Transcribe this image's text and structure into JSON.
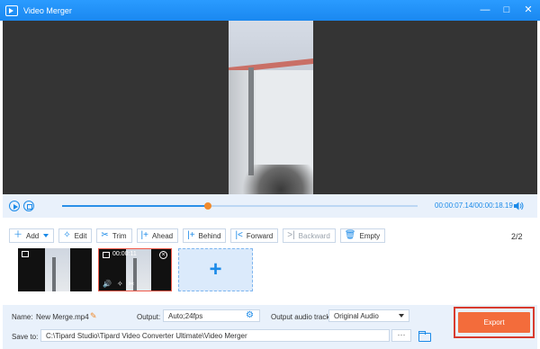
{
  "window": {
    "title": "Video Merger",
    "minimize": "—",
    "maximize": "□",
    "close": "✕"
  },
  "player": {
    "current_time": "00:00:07.14",
    "separator": "/",
    "total_time": "00:00:18.19",
    "progress": 0.41
  },
  "toolbar": {
    "add": "Add",
    "edit": "Edit",
    "trim": "Trim",
    "ahead": "Ahead",
    "behind": "Behind",
    "forward": "Forward",
    "backward": "Backward",
    "empty": "Empty"
  },
  "counter": {
    "current": "2",
    "separator": "/",
    "total": "2"
  },
  "clips": [
    {
      "duration": ""
    },
    {
      "duration": "00:00:11"
    }
  ],
  "settings": {
    "name_label": "Name:",
    "name_value": "New Merge.mp4",
    "output_label": "Output:",
    "output_value": "Auto;24fps",
    "audio_label": "Output audio track:",
    "audio_value": "Original Audio",
    "save_label": "Save to:",
    "save_path": "C:\\Tipard Studio\\Tipard Video Converter Ultimate\\Video Merger",
    "dots": "···"
  },
  "export": {
    "label": "Export"
  },
  "colors": {
    "accent": "#1b8ae8",
    "export": "#f36c3b",
    "highlight": "#d83b2e",
    "knob": "#f08a2c"
  }
}
